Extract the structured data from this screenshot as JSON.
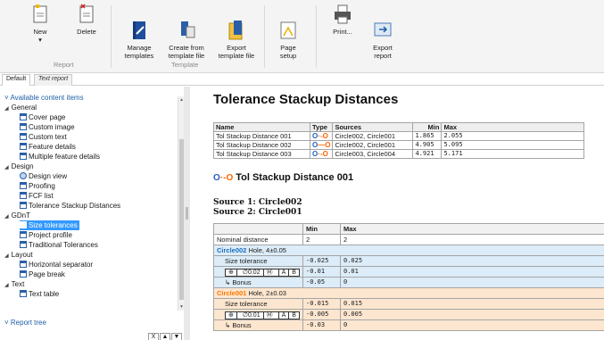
{
  "ribbon": {
    "buttons": [
      {
        "label": "New",
        "sub": "▾",
        "icon": "new-document-icon"
      },
      {
        "label": "Delete",
        "icon": "delete-document-icon"
      },
      {
        "label": "Manage\ntemplates",
        "icon": "manage-templates-icon"
      },
      {
        "label": "Create from\ntemplate file",
        "icon": "create-from-template-icon"
      },
      {
        "label": "Export\ntemplate file",
        "icon": "export-template-icon"
      },
      {
        "label": "Page\nsetup",
        "icon": "page-setup-icon"
      },
      {
        "label": "Print...",
        "icon": "print-icon"
      },
      {
        "label": "Export\nreport",
        "icon": "export-report-icon"
      }
    ],
    "groups": {
      "report": "Report",
      "template": "Template"
    }
  },
  "tabs": {
    "default": "Default",
    "text_report": "Text report"
  },
  "left": {
    "available_header": "Available content items",
    "groups": {
      "general": "General",
      "design": "Design",
      "gdnt": "GDnT",
      "layout": "Layout",
      "text": "Text"
    },
    "items": {
      "cover_page": "Cover page",
      "custom_image": "Custom image",
      "custom_text": "Custom text",
      "feature_details": "Feature details",
      "multiple_feature_details": "Multiple feature details",
      "design_view": "Design view",
      "proofing": "Proofing",
      "fcf_list": "FCF list",
      "tolerance_stackup": "Tolerance Stackup Distances",
      "size_tolerances": "Size tolerances",
      "project_profile": "Project profile",
      "traditional_tolerances": "Traditional Tolerances",
      "horizontal_separator": "Horizontal separator",
      "page_break": "Page break",
      "text_table": "Text table"
    },
    "report_tree_header": "Report tree",
    "mini_buttons": {
      "x": "X",
      "up": "▲",
      "down": "▼"
    }
  },
  "report": {
    "title": "Tolerance Stackup Distances",
    "summary_headers": {
      "name": "Name",
      "type": "Type",
      "sources": "Sources",
      "min": "Min",
      "max": "Max"
    },
    "summary_rows": [
      {
        "name": "Tol Stackup Distance 001",
        "sources": "Circle002, Circle001",
        "min": "1.865",
        "max": "2.055"
      },
      {
        "name": "Tol Stackup Distance 002",
        "sources": "Circle002, Circle001",
        "min": "4.905",
        "max": "5.095"
      },
      {
        "name": "Tol Stackup Distance 003",
        "sources": "Circle003, Circle004",
        "min": "4.921",
        "max": "5.171"
      }
    ],
    "section_title": "Tol Stackup Distance 001",
    "source1": "Source 1: Circle002",
    "source2": "Source 2: Circle001",
    "detail_headers": {
      "min": "Min",
      "max": "Max"
    },
    "nominal": {
      "label": "Nominal distance",
      "min": "2",
      "max": "2"
    },
    "feature1": {
      "name": "Circle002",
      "desc": "Hole, 4±0.05"
    },
    "feature1_rows": {
      "size": {
        "label": "Size tolerance",
        "min": "-0.025",
        "max": "0.025"
      },
      "fcf": {
        "tol": "∅0.02",
        "mod": "Ⓜ",
        "a": "A",
        "b": "B",
        "min": "-0.01",
        "max": "0.01"
      },
      "bonus": {
        "label": "Bonus",
        "min": "-0.05",
        "max": "0"
      }
    },
    "feature2": {
      "name": "Circle001",
      "desc": "Hole, 2±0.03"
    },
    "feature2_rows": {
      "size": {
        "label": "Size tolerance",
        "min": "-0.015",
        "max": "0.015"
      },
      "fcf": {
        "tol": "∅0.01",
        "mod": "Ⓜ",
        "a": "A",
        "b": "B",
        "min": "-0.005",
        "max": "0.005"
      },
      "bonus": {
        "label": "Bonus",
        "min": "-0.03",
        "max": "0"
      }
    }
  },
  "colors": {
    "accent": "#1f5fa8",
    "selection": "#3399ff",
    "orange": "#ff7700",
    "row_blue": "#dcecf8",
    "row_orange": "#fde6cf"
  }
}
